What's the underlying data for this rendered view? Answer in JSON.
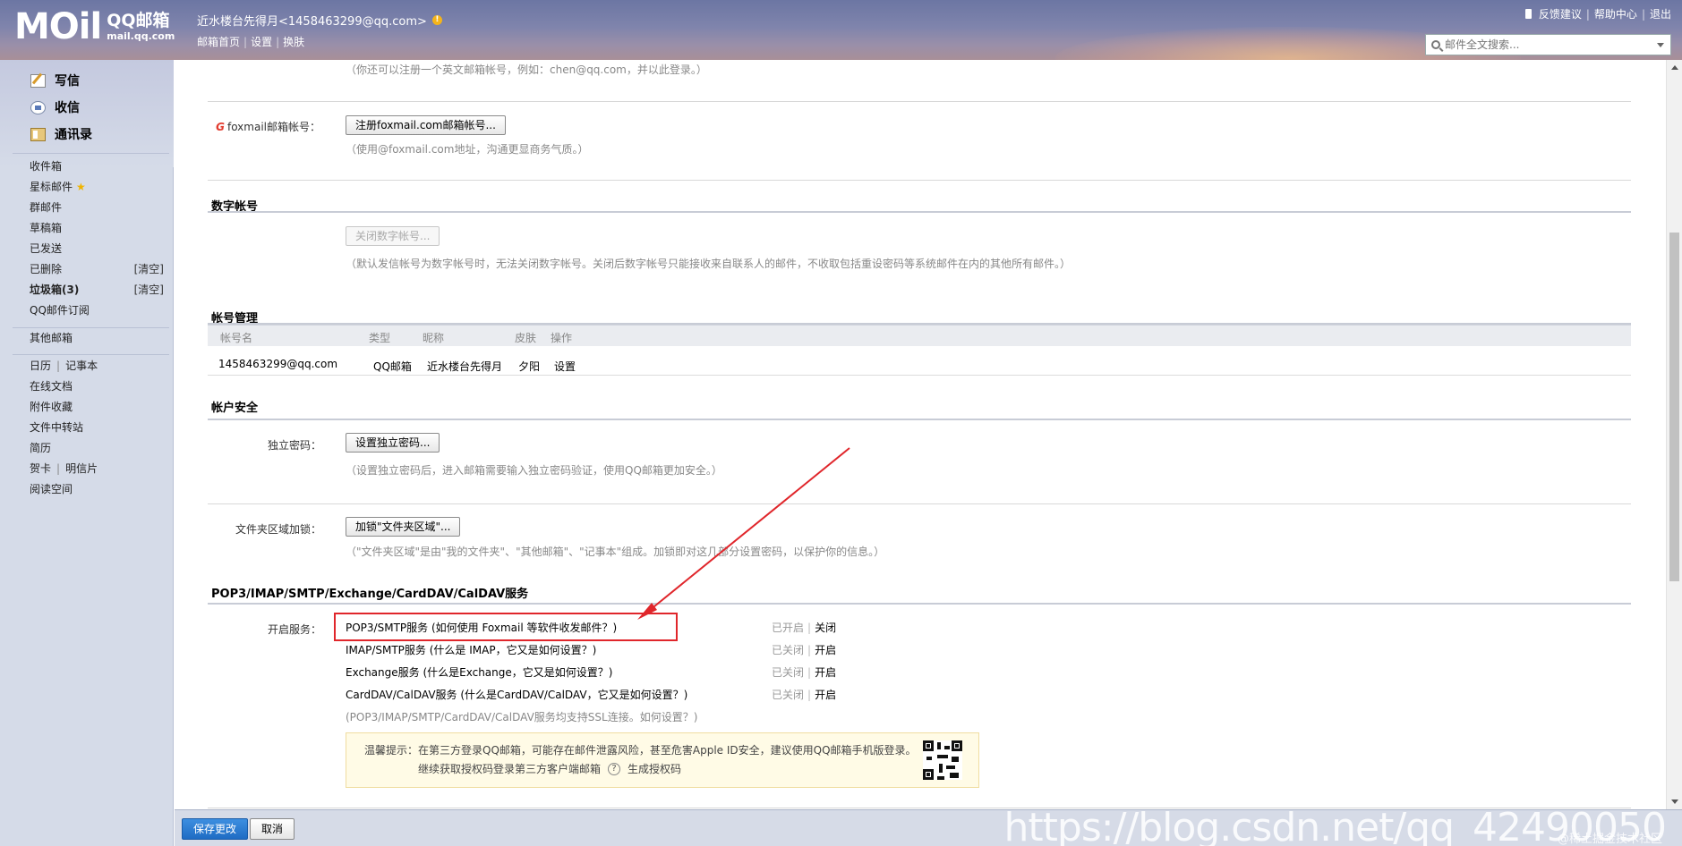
{
  "header": {
    "logo_main": "MOil",
    "logo_cn": "QQ邮箱",
    "logo_domain": "mail.qq.com",
    "username": "近水楼台先得月<1458463299@qq.com>",
    "nav": [
      "邮箱首页",
      "设置",
      "换肤"
    ],
    "top_links": [
      "反馈建议",
      "帮助中心",
      "退出"
    ],
    "search_placeholder": "邮件全文搜索..."
  },
  "sidebar": {
    "main": [
      {
        "label": "写信",
        "icon": "pencil-icon"
      },
      {
        "label": "收信",
        "icon": "inbox-icon"
      },
      {
        "label": "通讯录",
        "icon": "contacts-icon"
      }
    ],
    "folders": [
      {
        "label": "收件箱"
      },
      {
        "label": "星标邮件"
      },
      {
        "label": "群邮件"
      },
      {
        "label": "草稿箱"
      },
      {
        "label": "已发送"
      },
      {
        "label": "已删除",
        "action": "[清空]"
      },
      {
        "label": "垃圾箱(3)",
        "action": "[清空]"
      },
      {
        "label": "QQ邮件订阅"
      }
    ],
    "other_mailbox": "其他邮箱",
    "tools": {
      "calendar": "日历",
      "notepad": "记事本",
      "online_docs": "在线文档",
      "attachments": "附件收藏",
      "file_transfer": "文件中转站",
      "resume": "简历",
      "card": "贺卡",
      "postcard": "明信片",
      "reading": "阅读空间"
    }
  },
  "content": {
    "english_hint": "（你还可以注册一个英文邮箱帐号，例如：chen@qq.com，并以此登录。）",
    "foxmail_label": "foxmail邮箱帐号：",
    "foxmail_button": "注册foxmail.com邮箱帐号...",
    "foxmail_hint": "（使用@foxmail.com地址，沟通更显商务气质。）",
    "digital_title": "数字帐号",
    "digital_button": "关闭数字帐号...",
    "digital_hint": "（默认发信帐号为数字帐号时，无法关闭数字帐号。关闭后数字帐号只能接收来自联系人的邮件，不收取包括重设密码等系统邮件在内的其他所有邮件。）",
    "account_mgmt_title": "帐号管理",
    "account_table": {
      "headers": [
        "帐号名",
        "类型",
        "昵称",
        "皮肤",
        "操作"
      ],
      "row": [
        "1458463299@qq.com",
        "QQ邮箱",
        "近水楼台先得月",
        "夕阳",
        "设置"
      ]
    },
    "security_title": "帐户安全",
    "indep_pwd_label": "独立密码：",
    "indep_pwd_button": "设置独立密码...",
    "indep_pwd_hint": "（设置独立密码后，进入邮箱需要输入独立密码验证，使用QQ邮箱更加安全。）",
    "folder_lock_label": "文件夹区域加锁：",
    "folder_lock_button": "加锁\"文件夹区域\"...",
    "folder_lock_hint": "（\"文件夹区域\"是由\"我的文件夹\"、\"其他邮箱\"、\"记事本\"组成。加锁即对这几部分设置密码，以保护你的信息。）",
    "services_title": "POP3/IMAP/SMTP/Exchange/CardDAV/CalDAV服务",
    "services_label": "开启服务：",
    "services": [
      {
        "name": "POP3/SMTP服务 (如何使用 Foxmail 等软件收发邮件？)",
        "state": "已开启",
        "action": "关闭"
      },
      {
        "name": "IMAP/SMTP服务 (什么是 IMAP，它又是如何设置？)",
        "state": "已关闭",
        "action": "开启"
      },
      {
        "name": "Exchange服务 (什么是Exchange，它又是如何设置？)",
        "state": "已关闭",
        "action": "开启"
      },
      {
        "name": "CardDAV/CalDAV服务 (什么是CardDAV/CalDAV，它又是如何设置？)",
        "state": "已关闭",
        "action": "开启"
      }
    ],
    "ssl_hint": "(POP3/IMAP/SMTP/CardDAV/CalDAV服务均支持SSL连接。如何设置？)",
    "tip_line1": "温馨提示：在第三方登录QQ邮箱，可能存在邮件泄露风险，甚至危害Apple ID安全，建议使用QQ邮箱手机版登录。",
    "tip_line2_prefix": "继续获取授权码登录第三方客户端邮箱",
    "tip_help": "?",
    "tip_link": "生成授权码"
  },
  "bottom": {
    "save": "保存更改",
    "cancel": "取消"
  },
  "watermark": "https://blog.csdn.net/qq_42490050",
  "watermark_small": "@稀土掘金技术社区",
  "colors": {
    "highlight_box": "#e0262b",
    "arrow": "#e0262b",
    "primary_button": "#1f6cc4"
  }
}
